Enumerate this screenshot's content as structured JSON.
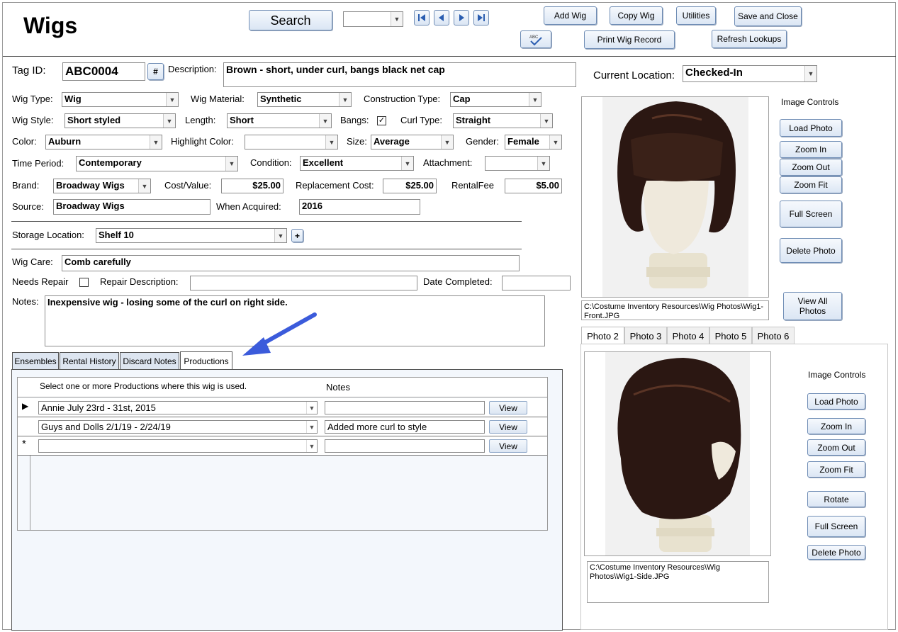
{
  "form": {
    "title": "Wigs"
  },
  "toolbar": {
    "search_label": "Search",
    "add_wig": "Add Wig",
    "copy_wig": "Copy Wig",
    "utilities": "Utilities",
    "save_close": "Save and Close",
    "print_record": "Print Wig Record",
    "refresh_lookups": "Refresh Lookups",
    "nav": [
      "first-record-icon",
      "previous-record-icon",
      "next-record-icon",
      "last-record-icon"
    ],
    "spellcheck_icon": "spellcheck-icon"
  },
  "fields": {
    "tag_id": {
      "label": "Tag ID:",
      "value": "ABC0004",
      "hash_button": "#"
    },
    "description": {
      "label": "Description:",
      "value": "Brown - short, under curl, bangs  black net cap"
    },
    "current_location": {
      "label": "Current Location:",
      "value": "Checked-In"
    },
    "wig_type": {
      "label": "Wig Type:",
      "value": "Wig"
    },
    "wig_material": {
      "label": "Wig Material:",
      "value": "Synthetic"
    },
    "construction_type": {
      "label": "Construction Type:",
      "value": "Cap"
    },
    "wig_style": {
      "label": "Wig Style:",
      "value": "Short styled"
    },
    "length": {
      "label": "Length:",
      "value": "Short"
    },
    "bangs": {
      "label": "Bangs:",
      "checked": true
    },
    "curl_type": {
      "label": "Curl Type:",
      "value": "Straight"
    },
    "color": {
      "label": "Color:",
      "value": "Auburn"
    },
    "highlight_color": {
      "label": "Highlight Color:",
      "value": ""
    },
    "size": {
      "label": "Size:",
      "value": "Average"
    },
    "gender": {
      "label": "Gender:",
      "value": "Female"
    },
    "time_period": {
      "label": "Time Period:",
      "value": "Contemporary"
    },
    "condition": {
      "label": "Condition:",
      "value": "Excellent"
    },
    "attachment": {
      "label": "Attachment:",
      "value": ""
    },
    "brand": {
      "label": "Brand:",
      "value": "Broadway Wigs"
    },
    "cost_value": {
      "label": "Cost/Value:",
      "value": "$25.00"
    },
    "replacement_cost": {
      "label": "Replacement Cost:",
      "value": "$25.00"
    },
    "rental_fee": {
      "label": "RentalFee",
      "value": "$5.00"
    },
    "source": {
      "label": "Source:",
      "value": "Broadway Wigs"
    },
    "when_acquired": {
      "label": "When Acquired:",
      "value": "2016"
    },
    "storage_location": {
      "label": "Storage Location:",
      "value": "Shelf 10",
      "add_button": "+"
    },
    "wig_care": {
      "label": "Wig Care:",
      "value": "Comb carefully"
    },
    "needs_repair": {
      "label": "Needs Repair",
      "checked": false
    },
    "repair_description": {
      "label": "Repair Description:",
      "value": ""
    },
    "date_completed": {
      "label": "Date Completed:",
      "value": ""
    },
    "notes": {
      "label": "Notes:",
      "value": "Inexpensive wig - losing some of the curl on right side."
    }
  },
  "tabs": [
    "Ensembles",
    "Rental History",
    "Discard Notes",
    "Productions"
  ],
  "productions": {
    "header_select": "Select one or more Productions where this wig is used.",
    "header_notes": "Notes",
    "view_label": "View",
    "rows": [
      {
        "marker": "▶",
        "production": "Annie July 23rd - 31st, 2015",
        "notes": ""
      },
      {
        "marker": "",
        "production": "Guys and Dolls 2/1/19 - 2/24/19",
        "notes": "Added more curl to style"
      },
      {
        "marker": "*",
        "production": "",
        "notes": ""
      }
    ]
  },
  "photo1": {
    "controls_title": "Image Controls",
    "load": "Load Photo",
    "zoom_in": "Zoom In",
    "zoom_out": "Zoom Out",
    "zoom_fit": "Zoom Fit",
    "full_screen": "Full Screen",
    "delete": "Delete Photo",
    "view_all": "View All Photos",
    "path": "C:\\Costume Inventory Resources\\Wig Photos\\Wig1-Front.JPG"
  },
  "photo_tabs": [
    "Photo 2",
    "Photo 3",
    "Photo 4",
    "Photo 5",
    "Photo 6"
  ],
  "photo2": {
    "controls_title": "Image Controls",
    "load": "Load Photo",
    "zoom_in": "Zoom In",
    "zoom_out": "Zoom Out",
    "zoom_fit": "Zoom Fit",
    "rotate": "Rotate",
    "full_screen": "Full Screen",
    "delete": "Delete Photo",
    "path": "C:\\Costume Inventory Resources\\Wig Photos\\Wig1-Side.JPG"
  },
  "colors": {
    "button_border": "#6f8db5",
    "annotation_arrow": "#3b5bdb",
    "wig_hair": "#2b1712"
  }
}
